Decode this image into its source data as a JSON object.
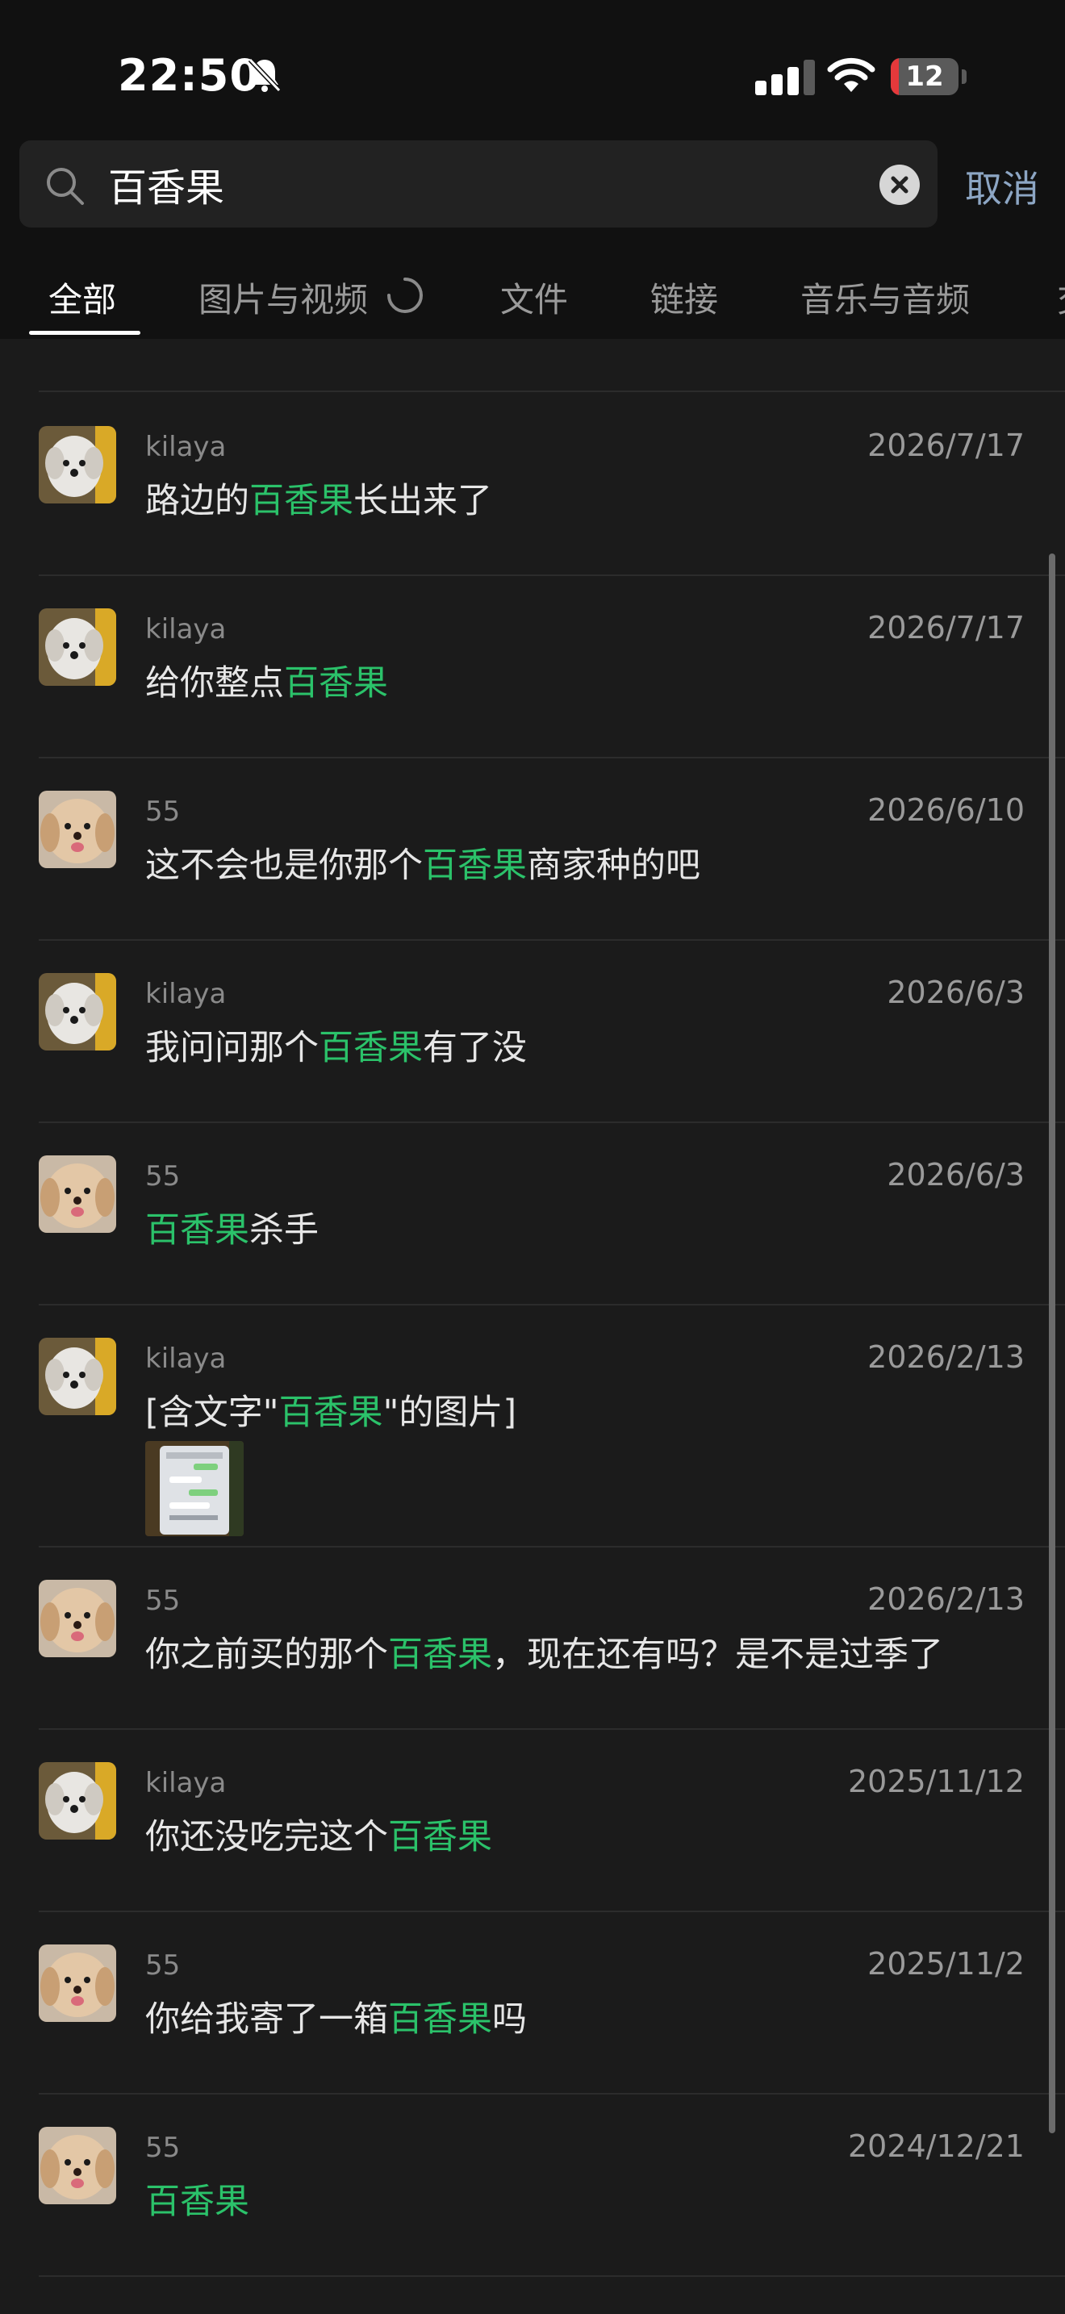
{
  "status_bar": {
    "time": "22:50",
    "battery_level": "12",
    "battery_fraction": 0.12,
    "icons": [
      "bell-slash-icon",
      "cellular-signal-icon",
      "wifi-icon",
      "battery-icon"
    ]
  },
  "search": {
    "query": "百香果",
    "cancel_label": "取消"
  },
  "tabs": [
    {
      "label": "全部",
      "active": true
    },
    {
      "label": "图片与视频",
      "active": false,
      "loading": true
    },
    {
      "label": "文件",
      "active": false
    },
    {
      "label": "链接",
      "active": false
    },
    {
      "label": "音乐与音频",
      "active": false
    },
    {
      "label": "交",
      "active": false
    }
  ],
  "colors": {
    "highlight": "#2bc26a",
    "cancel": "#8da6c4",
    "background": "#1b1b1b"
  },
  "results": [
    {
      "sender": "kilaya",
      "date": "2026/7/17",
      "avatar": "white-dog",
      "message": {
        "before": "路边的",
        "match": "百香果",
        "after": "长出来了"
      }
    },
    {
      "sender": "kilaya",
      "date": "2026/7/17",
      "avatar": "white-dog",
      "message": {
        "before": "给你整点",
        "match": "百香果",
        "after": ""
      }
    },
    {
      "sender": "55",
      "date": "2026/6/10",
      "avatar": "tan-dog",
      "message": {
        "before": "这不会也是你那个",
        "match": "百香果",
        "after": "商家种的吧"
      }
    },
    {
      "sender": "kilaya",
      "date": "2026/6/3",
      "avatar": "white-dog",
      "message": {
        "before": "我问问那个",
        "match": "百香果",
        "after": "有了没"
      }
    },
    {
      "sender": "55",
      "date": "2026/6/3",
      "avatar": "tan-dog",
      "message": {
        "before": "",
        "match": "百香果",
        "after": "杀手"
      }
    },
    {
      "sender": "kilaya",
      "date": "2026/2/13",
      "avatar": "white-dog",
      "message": {
        "before": "[含文字\"",
        "match": "百香果",
        "after": "\"的图片]"
      },
      "has_thumbnail": true
    },
    {
      "sender": "55",
      "date": "2026/2/13",
      "avatar": "tan-dog",
      "message": {
        "before": "你之前买的那个",
        "match": "百香果",
        "after": "，现在还有吗？是不是过季了"
      }
    },
    {
      "sender": "kilaya",
      "date": "2025/11/12",
      "avatar": "white-dog",
      "message": {
        "before": "你还没吃完这个",
        "match": "百香果",
        "after": ""
      }
    },
    {
      "sender": "55",
      "date": "2025/11/2",
      "avatar": "tan-dog",
      "message": {
        "before": "你给我寄了一箱",
        "match": "百香果",
        "after": "吗"
      }
    },
    {
      "sender": "55",
      "date": "2024/12/21",
      "avatar": "tan-dog",
      "message": {
        "before": "",
        "match": "百香果",
        "after": ""
      }
    }
  ]
}
